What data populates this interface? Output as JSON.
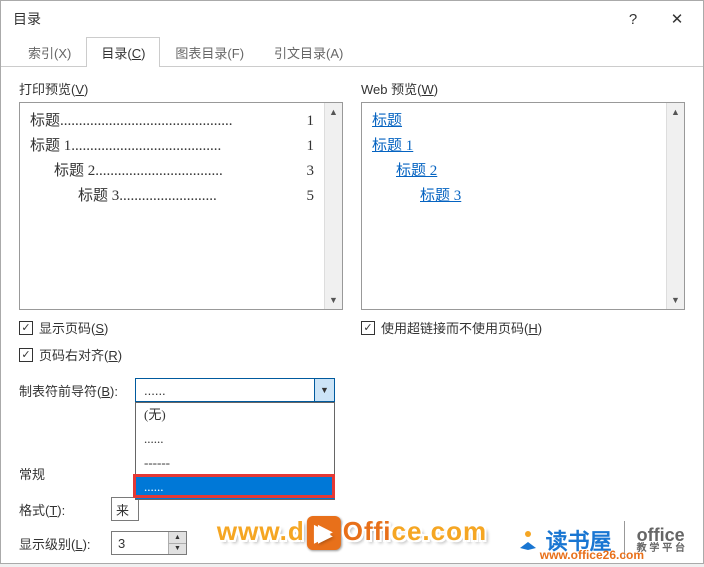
{
  "titlebar": {
    "title": "目录",
    "help": "?",
    "close": "✕"
  },
  "tabs": [
    {
      "label": "索引(X)"
    },
    {
      "label": "目录(C)"
    },
    {
      "label": "图表目录(F)"
    },
    {
      "label": "引文目录(A)"
    }
  ],
  "print_preview_label": "打印预览(V)",
  "web_preview_label": "Web 预览(W)",
  "print_preview": [
    {
      "indent": 0,
      "title": "标题",
      "dots": "..............................................",
      "page": "1"
    },
    {
      "indent": 0,
      "title": "标题 1",
      "dots": "........................................",
      "page": "1"
    },
    {
      "indent": 1,
      "title": "标题 2",
      "dots": "..................................",
      "page": "3"
    },
    {
      "indent": 2,
      "title": "标题 3",
      "dots": "..........................",
      "page": "5"
    }
  ],
  "web_preview": [
    {
      "indent": 0,
      "text": "标题"
    },
    {
      "indent": 0,
      "text": "标题 1"
    },
    {
      "indent": 1,
      "text": "标题 2"
    },
    {
      "indent": 2,
      "text": "标题 3"
    }
  ],
  "checks": {
    "show_page_numbers": "显示页码(S)",
    "right_align": "页码右对齐(R)",
    "use_hyperlinks": "使用超链接而不使用页码(H)"
  },
  "leader": {
    "label": "制表符前导符(B):",
    "value": "......",
    "options": [
      "(无)",
      "......",
      "------",
      "......"
    ]
  },
  "general_label": "常规",
  "format": {
    "label": "格式(T):",
    "value": "来"
  },
  "levels": {
    "label": "显示级别(L):",
    "value": "3"
  },
  "watermark": {
    "dushuwu": "读书屋",
    "office": "office",
    "office_sub": "教 学 平 台",
    "url": "www.d",
    "url2": "ce.com",
    "sub_url": "www.office26.com"
  }
}
